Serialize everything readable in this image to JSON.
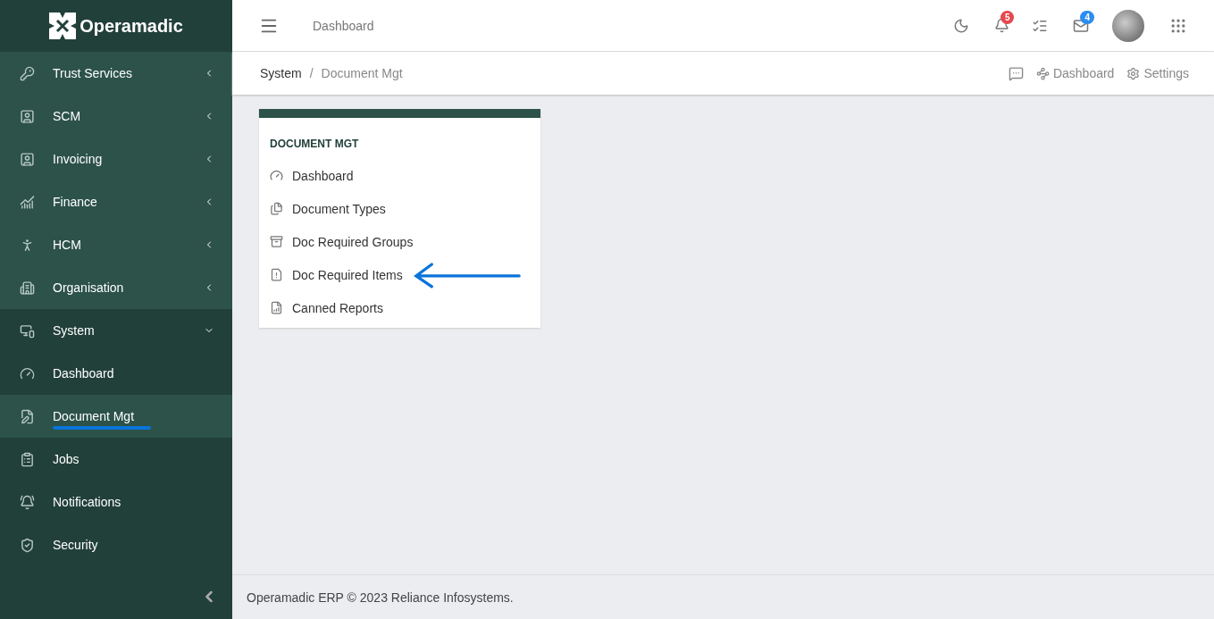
{
  "sidebar": {
    "logo": "Operamadic",
    "items": [
      {
        "label": "Trust Services",
        "expanded": false
      },
      {
        "label": "SCM",
        "expanded": false
      },
      {
        "label": "Invoicing",
        "expanded": false
      },
      {
        "label": "Finance",
        "expanded": false
      },
      {
        "label": "HCM",
        "expanded": false
      },
      {
        "label": "Organisation",
        "expanded": false
      },
      {
        "label": "System",
        "expanded": true,
        "children": [
          {
            "label": "Dashboard",
            "selected": false
          },
          {
            "label": "Document Mgt",
            "selected": true
          },
          {
            "label": "Jobs",
            "selected": false
          },
          {
            "label": "Notifications",
            "selected": false
          },
          {
            "label": "Security",
            "selected": false
          }
        ]
      }
    ]
  },
  "header": {
    "title": "Dashboard",
    "notifications_badge": "5",
    "messages_badge": "4"
  },
  "breadcrumb": {
    "items": [
      "System",
      "Document Mgt"
    ],
    "separator": "/",
    "links": [
      "Dashboard",
      "Settings"
    ]
  },
  "card": {
    "title": "DOCUMENT MGT",
    "items": [
      {
        "label": "Dashboard"
      },
      {
        "label": "Document Types"
      },
      {
        "label": "Doc Required Groups"
      },
      {
        "label": "Doc Required Items"
      },
      {
        "label": "Canned Reports"
      }
    ]
  },
  "footer": "Operamadic ERP © 2023 Reliance Infosystems."
}
